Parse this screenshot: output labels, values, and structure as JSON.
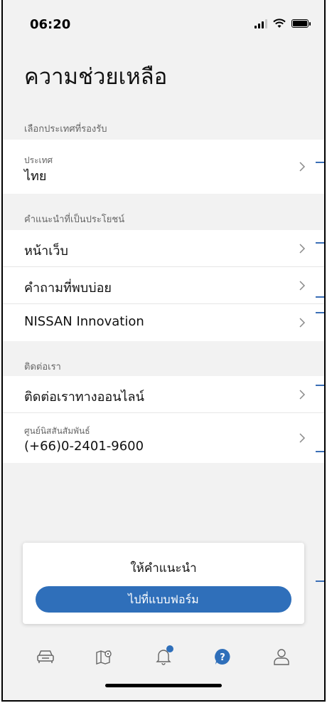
{
  "status": {
    "time": "06:20"
  },
  "page": {
    "title": "ความช่วยเหลือ"
  },
  "sections": {
    "country": {
      "label": "เลือกประเทศที่รองรับ",
      "item_small": "ประเทศ",
      "item_value": "ไทย"
    },
    "tips": {
      "label": "คำแนะนำที่เป็นประโยชน์",
      "items": [
        "หน้าเว็บ",
        "คำถามที่พบบ่อย",
        "NISSAN Innovation"
      ]
    },
    "contact": {
      "label": "ติดต่อเรา",
      "online": "ติดต่อเราทางออนไลน์",
      "center_small": "ศูนย์นิสสันสัมพันธ์",
      "center_phone": "(+66)0-2401-9600"
    }
  },
  "feedback": {
    "title": "ให้คำแนะนำ",
    "button": "ไปที่แบบฟอร์ม"
  },
  "tabbar": {
    "items": [
      "car-icon",
      "map-pin-icon",
      "bell-icon",
      "help-icon",
      "user-icon"
    ],
    "active": "help-icon",
    "accent": "#2f6fba"
  }
}
